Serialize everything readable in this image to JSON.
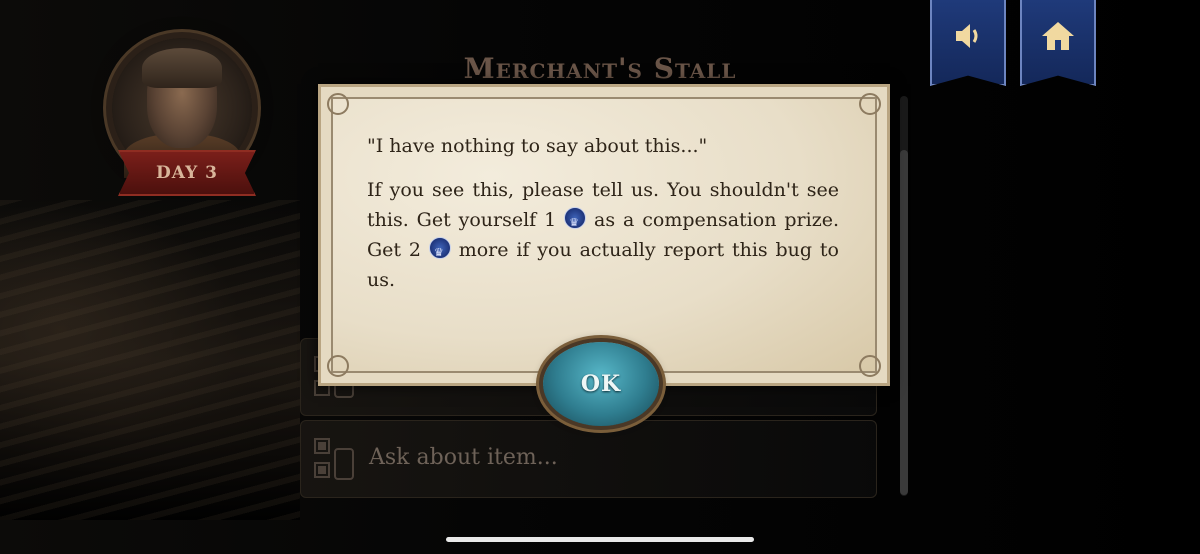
{
  "header": {
    "title": "Merchant's Stall",
    "day_label": "DAY 3",
    "sound_icon": "speaker-icon",
    "home_icon": "home-icon"
  },
  "list": {
    "items": [
      {
        "label": ""
      },
      {
        "label": "Ask about item..."
      }
    ]
  },
  "dialog": {
    "quote": "\"I have nothing to say about this...\"",
    "body_part1": "If you see this, please tell us. You shouldn't see this. Get yourself 1",
    "body_part2": "as a compensation prize. Get 2",
    "body_part3": "more if you actually report this bug to us.",
    "currency_icon": "crown-coin-icon",
    "ok_label": "OK"
  },
  "colors": {
    "banner_blue": "#1f3a7a",
    "parchment": "#ece3cf",
    "ok_teal": "#2f7d8f",
    "day_ribbon_red": "#7a1f1a"
  }
}
